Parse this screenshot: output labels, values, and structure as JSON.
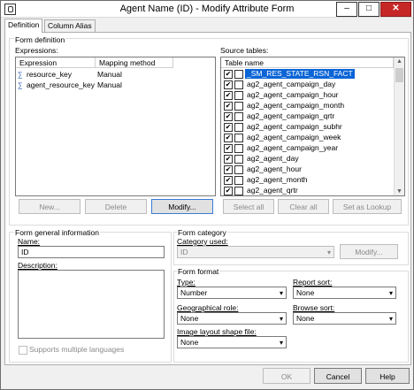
{
  "window": {
    "title": "Agent Name (ID) - Modify Attribute Form",
    "minimize": "–",
    "maximize": "□",
    "close": "✕"
  },
  "tabs": [
    {
      "label": "Definition"
    },
    {
      "label": "Column Alias"
    }
  ],
  "form_definition": {
    "group_label": "Form definition",
    "expressions_label": "Expressions:",
    "columns": [
      "Expression",
      "Mapping method"
    ],
    "rows": [
      {
        "expression": "resource_key",
        "mapping": "Manual"
      },
      {
        "expression": "agent_resource_key",
        "mapping": "Manual"
      }
    ],
    "buttons": {
      "new": "New...",
      "delete": "Delete",
      "modify": "Modify..."
    }
  },
  "source_tables": {
    "label": "Source tables:",
    "column": "Table name",
    "items": [
      "_SM_RES_STATE_RSN_FACT",
      "ag2_agent_campaign_day",
      "ag2_agent_campaign_hour",
      "ag2_agent_campaign_month",
      "ag2_agent_campaign_qrtr",
      "ag2_agent_campaign_subhr",
      "ag2_agent_campaign_week",
      "ag2_agent_campaign_year",
      "ag2_agent_day",
      "ag2_agent_hour",
      "ag2_agent_month",
      "ag2_agent_qrtr"
    ],
    "buttons": {
      "select_all": "Select all",
      "clear_all": "Clear all",
      "set_lookup": "Set as Lookup"
    }
  },
  "general_info": {
    "group_label": "Form general information",
    "name_label": "Name:",
    "name_value": "ID",
    "description_label": "Description:",
    "description_value": "",
    "multi_lang": "Supports multiple languages"
  },
  "category": {
    "group_label": "Form category",
    "used_label": "Category used:",
    "used_value": "ID",
    "modify_button": "Modify..."
  },
  "format": {
    "group_label": "Form format",
    "type_label": "Type:",
    "type_value": "Number",
    "report_sort_label": "Report sort:",
    "report_sort_value": "None",
    "geo_label": "Geographical role:",
    "geo_value": "None",
    "browse_sort_label": "Browse sort:",
    "browse_sort_value": "None",
    "shape_label": "Image layout shape file:",
    "shape_value": "None"
  },
  "footer": {
    "ok": "OK",
    "cancel": "Cancel",
    "help": "Help"
  }
}
